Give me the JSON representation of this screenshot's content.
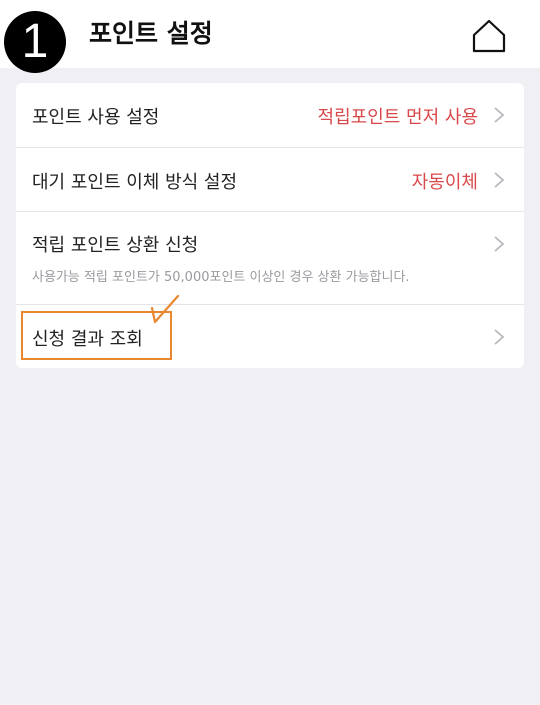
{
  "header": {
    "step_number": "1",
    "title": "포인트 설정",
    "home_icon": "home-icon"
  },
  "settings": [
    {
      "label": "포인트 사용 설정",
      "value": "적립포인트 먼저 사용"
    },
    {
      "label": "대기 포인트 이체 방식 설정",
      "value": "자동이체"
    },
    {
      "label": "적립 포인트 상환 신청",
      "description": "사용가능 적립 포인트가 50,000포인트 이상인 경우 상환 가능합니다."
    },
    {
      "label": "신청 결과 조회"
    }
  ],
  "colors": {
    "accent_value": "#d9484b",
    "highlight": "#e8872e",
    "background": "#efeff4"
  }
}
